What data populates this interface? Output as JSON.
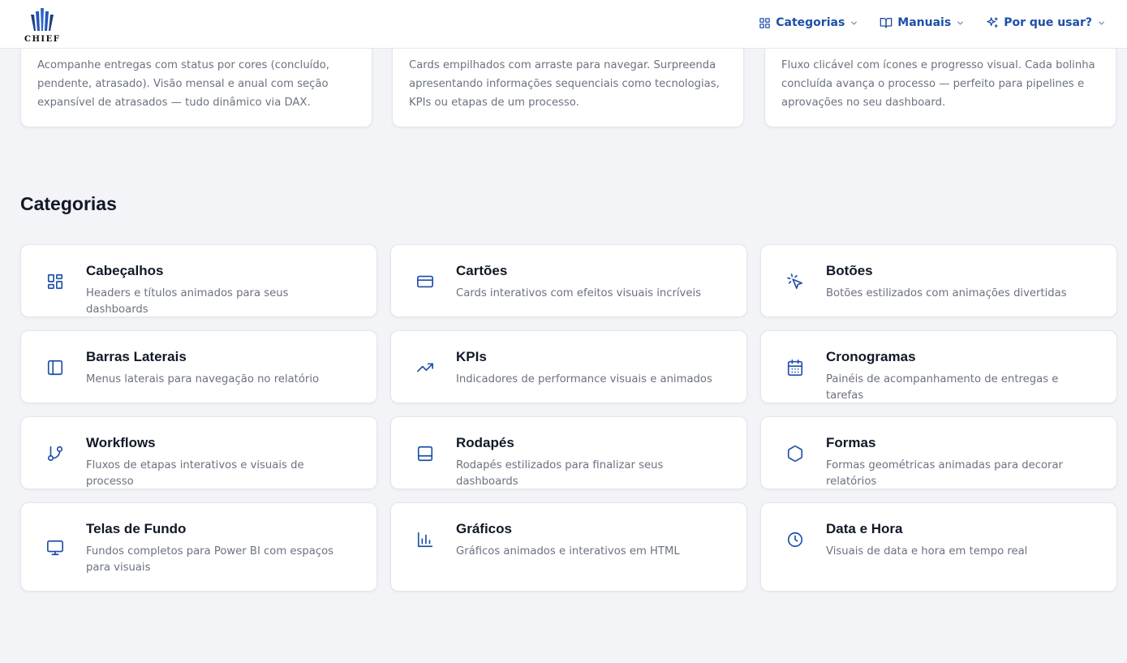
{
  "brand": {
    "logo_text": "CHIEF",
    "accent": "#1e4fa8"
  },
  "nav": {
    "categorias": "Categorias",
    "manuais": "Manuais",
    "por_que_usar": "Por que usar?"
  },
  "top_cards": [
    {
      "text": "Acompanhe entregas com status por cores (concluído, pendente, atrasado). Visão mensal e anual com seção expansível de atrasados — tudo dinâmico via DAX."
    },
    {
      "text": "Cards empilhados com arraste para navegar. Surpreenda apresentando informações sequenciais como tecnologias, KPIs ou etapas de um processo."
    },
    {
      "text": "Fluxo clicável com ícones e progresso visual. Cada bolinha concluída avança o processo — perfeito para pipelines e aprovações no seu dashboard."
    }
  ],
  "section_title": "Categorias",
  "categories": [
    {
      "icon": "layout-grid-icon",
      "title": "Cabeçalhos",
      "desc": "Headers e títulos animados para seus dashboards"
    },
    {
      "icon": "credit-card-icon",
      "title": "Cartões",
      "desc": "Cards interativos com efeitos visuais incríveis"
    },
    {
      "icon": "pointer-click-icon",
      "title": "Botões",
      "desc": "Botões estilizados com animações divertidas"
    },
    {
      "icon": "sidebar-panel-icon",
      "title": "Barras Laterais",
      "desc": "Menus laterais para navegação no relatório"
    },
    {
      "icon": "trending-up-icon",
      "title": "KPIs",
      "desc": "Indicadores de performance visuais e animados"
    },
    {
      "icon": "calendar-icon",
      "title": "Cronogramas",
      "desc": "Painéis de acompanhamento de entregas e tarefas"
    },
    {
      "icon": "git-branch-icon",
      "title": "Workflows",
      "desc": "Fluxos de etapas interativos e visuais de processo"
    },
    {
      "icon": "footer-panel-icon",
      "title": "Rodapés",
      "desc": "Rodapés estilizados para finalizar seus dashboards"
    },
    {
      "icon": "hexagon-icon",
      "title": "Formas",
      "desc": "Formas geométricas animadas para decorar relatórios"
    },
    {
      "icon": "monitor-icon",
      "title": "Telas de Fundo",
      "desc": "Fundos completos para Power BI com espaços para visuais"
    },
    {
      "icon": "bar-chart-icon",
      "title": "Gráficos",
      "desc": "Gráficos animados e interativos em HTML"
    },
    {
      "icon": "clock-icon",
      "title": "Data e Hora",
      "desc": "Visuais de data e hora em tempo real"
    }
  ]
}
